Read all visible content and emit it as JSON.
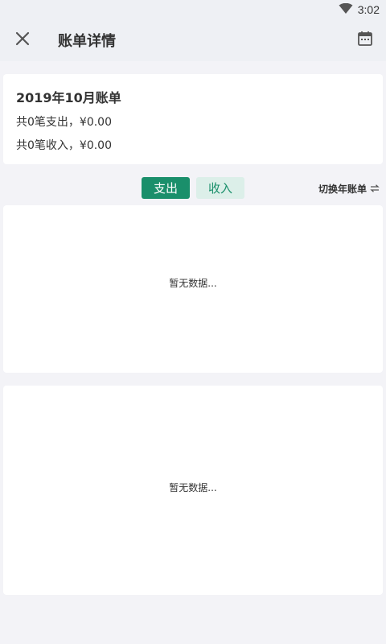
{
  "status_bar": {
    "time": "3:02",
    "icons": [
      "wifi-icon"
    ]
  },
  "header": {
    "title": "账单详情",
    "left_icon": "close-icon",
    "right_icon": "calendar-icon"
  },
  "summary": {
    "title": "2019年10月账单",
    "expense_line": "共0笔支出，¥0.00",
    "income_line": "共0笔收入，¥0.00"
  },
  "tabs": [
    {
      "label": "支出",
      "active": true
    },
    {
      "label": "收入",
      "active": false
    }
  ],
  "switch_year": {
    "label": "切换年账单",
    "icon": "swap-arrows-icon"
  },
  "panels": [
    {
      "empty_text": "暂无数据..."
    },
    {
      "empty_text": "暂无数据..."
    }
  ],
  "colors": {
    "accent": "#1a8f6b",
    "accent_light": "#dcefe9",
    "background": "#f3f3f7",
    "header_bg": "#eef0f4"
  }
}
